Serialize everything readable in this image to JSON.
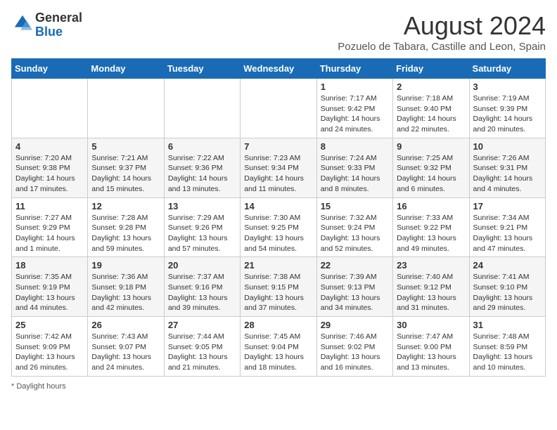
{
  "header": {
    "logo_line1": "General",
    "logo_line2": "Blue",
    "month_title": "August 2024",
    "subtitle": "Pozuelo de Tabara, Castille and Leon, Spain"
  },
  "calendar": {
    "headers": [
      "Sunday",
      "Monday",
      "Tuesday",
      "Wednesday",
      "Thursday",
      "Friday",
      "Saturday"
    ],
    "weeks": [
      [
        {
          "day": "",
          "info": ""
        },
        {
          "day": "",
          "info": ""
        },
        {
          "day": "",
          "info": ""
        },
        {
          "day": "",
          "info": ""
        },
        {
          "day": "1",
          "info": "Sunrise: 7:17 AM\nSunset: 9:42 PM\nDaylight: 14 hours and 24 minutes."
        },
        {
          "day": "2",
          "info": "Sunrise: 7:18 AM\nSunset: 9:40 PM\nDaylight: 14 hours and 22 minutes."
        },
        {
          "day": "3",
          "info": "Sunrise: 7:19 AM\nSunset: 9:39 PM\nDaylight: 14 hours and 20 minutes."
        }
      ],
      [
        {
          "day": "4",
          "info": "Sunrise: 7:20 AM\nSunset: 9:38 PM\nDaylight: 14 hours and 17 minutes."
        },
        {
          "day": "5",
          "info": "Sunrise: 7:21 AM\nSunset: 9:37 PM\nDaylight: 14 hours and 15 minutes."
        },
        {
          "day": "6",
          "info": "Sunrise: 7:22 AM\nSunset: 9:36 PM\nDaylight: 14 hours and 13 minutes."
        },
        {
          "day": "7",
          "info": "Sunrise: 7:23 AM\nSunset: 9:34 PM\nDaylight: 14 hours and 11 minutes."
        },
        {
          "day": "8",
          "info": "Sunrise: 7:24 AM\nSunset: 9:33 PM\nDaylight: 14 hours and 8 minutes."
        },
        {
          "day": "9",
          "info": "Sunrise: 7:25 AM\nSunset: 9:32 PM\nDaylight: 14 hours and 6 minutes."
        },
        {
          "day": "10",
          "info": "Sunrise: 7:26 AM\nSunset: 9:31 PM\nDaylight: 14 hours and 4 minutes."
        }
      ],
      [
        {
          "day": "11",
          "info": "Sunrise: 7:27 AM\nSunset: 9:29 PM\nDaylight: 14 hours and 1 minute."
        },
        {
          "day": "12",
          "info": "Sunrise: 7:28 AM\nSunset: 9:28 PM\nDaylight: 13 hours and 59 minutes."
        },
        {
          "day": "13",
          "info": "Sunrise: 7:29 AM\nSunset: 9:26 PM\nDaylight: 13 hours and 57 minutes."
        },
        {
          "day": "14",
          "info": "Sunrise: 7:30 AM\nSunset: 9:25 PM\nDaylight: 13 hours and 54 minutes."
        },
        {
          "day": "15",
          "info": "Sunrise: 7:32 AM\nSunset: 9:24 PM\nDaylight: 13 hours and 52 minutes."
        },
        {
          "day": "16",
          "info": "Sunrise: 7:33 AM\nSunset: 9:22 PM\nDaylight: 13 hours and 49 minutes."
        },
        {
          "day": "17",
          "info": "Sunrise: 7:34 AM\nSunset: 9:21 PM\nDaylight: 13 hours and 47 minutes."
        }
      ],
      [
        {
          "day": "18",
          "info": "Sunrise: 7:35 AM\nSunset: 9:19 PM\nDaylight: 13 hours and 44 minutes."
        },
        {
          "day": "19",
          "info": "Sunrise: 7:36 AM\nSunset: 9:18 PM\nDaylight: 13 hours and 42 minutes."
        },
        {
          "day": "20",
          "info": "Sunrise: 7:37 AM\nSunset: 9:16 PM\nDaylight: 13 hours and 39 minutes."
        },
        {
          "day": "21",
          "info": "Sunrise: 7:38 AM\nSunset: 9:15 PM\nDaylight: 13 hours and 37 minutes."
        },
        {
          "day": "22",
          "info": "Sunrise: 7:39 AM\nSunset: 9:13 PM\nDaylight: 13 hours and 34 minutes."
        },
        {
          "day": "23",
          "info": "Sunrise: 7:40 AM\nSunset: 9:12 PM\nDaylight: 13 hours and 31 minutes."
        },
        {
          "day": "24",
          "info": "Sunrise: 7:41 AM\nSunset: 9:10 PM\nDaylight: 13 hours and 29 minutes."
        }
      ],
      [
        {
          "day": "25",
          "info": "Sunrise: 7:42 AM\nSunset: 9:09 PM\nDaylight: 13 hours and 26 minutes."
        },
        {
          "day": "26",
          "info": "Sunrise: 7:43 AM\nSunset: 9:07 PM\nDaylight: 13 hours and 24 minutes."
        },
        {
          "day": "27",
          "info": "Sunrise: 7:44 AM\nSunset: 9:05 PM\nDaylight: 13 hours and 21 minutes."
        },
        {
          "day": "28",
          "info": "Sunrise: 7:45 AM\nSunset: 9:04 PM\nDaylight: 13 hours and 18 minutes."
        },
        {
          "day": "29",
          "info": "Sunrise: 7:46 AM\nSunset: 9:02 PM\nDaylight: 13 hours and 16 minutes."
        },
        {
          "day": "30",
          "info": "Sunrise: 7:47 AM\nSunset: 9:00 PM\nDaylight: 13 hours and 13 minutes."
        },
        {
          "day": "31",
          "info": "Sunrise: 7:48 AM\nSunset: 8:59 PM\nDaylight: 13 hours and 10 minutes."
        }
      ]
    ]
  },
  "footer": {
    "note": "Daylight hours"
  }
}
